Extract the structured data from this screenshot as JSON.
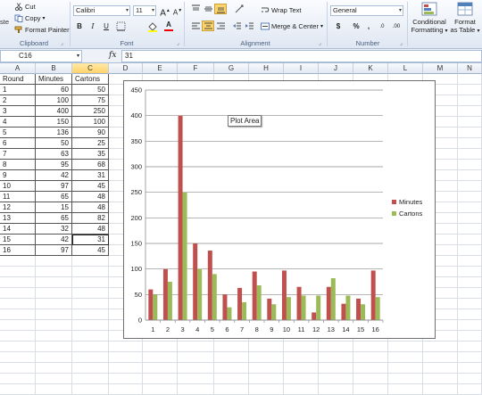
{
  "ribbon": {
    "clipboard": {
      "paste_partial": "ste",
      "cut": "Cut",
      "copy": "Copy",
      "format_painter": "Format Painter",
      "label": "Clipboard"
    },
    "font": {
      "name": "Calibri",
      "size": "11",
      "grow": "A",
      "shrink": "A",
      "bold": "B",
      "italic": "I",
      "underline": "U",
      "font_color": "A",
      "label": "Font"
    },
    "alignment": {
      "wrap_text": "Wrap Text",
      "merge_center": "Merge & Center",
      "label": "Alignment"
    },
    "number": {
      "format": "General",
      "currency": "$",
      "percent": "%",
      "comma": ",",
      "inc_decimal": ".0",
      "dec_decimal": ".00",
      "label": "Number"
    },
    "styles": {
      "conditional_1": "Conditional",
      "conditional_2": "Formatting",
      "format_table_1": "Format",
      "format_table_2": "as Table"
    }
  },
  "formula_bar": {
    "name_box": "C16",
    "fx": "fx",
    "value": "31"
  },
  "grid": {
    "columns": [
      "A",
      "B",
      "C",
      "D",
      "E",
      "F",
      "G",
      "H",
      "I",
      "J",
      "K",
      "L",
      "M",
      "N"
    ],
    "headers": [
      "Round",
      "Minutes",
      "Cartons"
    ],
    "rows": [
      [
        "1",
        "60",
        "50"
      ],
      [
        "2",
        "100",
        "75"
      ],
      [
        "3",
        "400",
        "250"
      ],
      [
        "4",
        "150",
        "100"
      ],
      [
        "5",
        "136",
        "90"
      ],
      [
        "6",
        "50",
        "25"
      ],
      [
        "7",
        "63",
        "35"
      ],
      [
        "8",
        "95",
        "68"
      ],
      [
        "9",
        "42",
        "31"
      ],
      [
        "10",
        "97",
        "45"
      ],
      [
        "11",
        "65",
        "48"
      ],
      [
        "12",
        "15",
        "48"
      ],
      [
        "13",
        "65",
        "82"
      ],
      [
        "14",
        "32",
        "48"
      ],
      [
        "15",
        "42",
        "31"
      ],
      [
        "16",
        "97",
        "45"
      ]
    ]
  },
  "chart_data": {
    "type": "bar",
    "categories": [
      "1",
      "2",
      "3",
      "4",
      "5",
      "6",
      "7",
      "8",
      "9",
      "10",
      "11",
      "12",
      "13",
      "14",
      "15",
      "16"
    ],
    "series": [
      {
        "name": "Minutes",
        "values": [
          60,
          100,
          400,
          150,
          136,
          50,
          63,
          95,
          42,
          97,
          65,
          15,
          65,
          32,
          42,
          97
        ],
        "color": "#c0504d"
      },
      {
        "name": "Cartons",
        "values": [
          50,
          75,
          250,
          100,
          90,
          25,
          35,
          68,
          31,
          45,
          48,
          48,
          82,
          48,
          31,
          45
        ],
        "color": "#9bbb59"
      }
    ],
    "y_ticks": [
      "0",
      "50",
      "100",
      "150",
      "200",
      "250",
      "300",
      "350",
      "400",
      "450"
    ],
    "ylim": [
      0,
      450
    ],
    "grid": true,
    "legend": "right",
    "title": "",
    "xlabel": "",
    "ylabel": ""
  },
  "tooltip": "Plot Area",
  "colors": {
    "selected_header": "#ffd36b",
    "ribbon_bg": "#dfe7f3"
  }
}
